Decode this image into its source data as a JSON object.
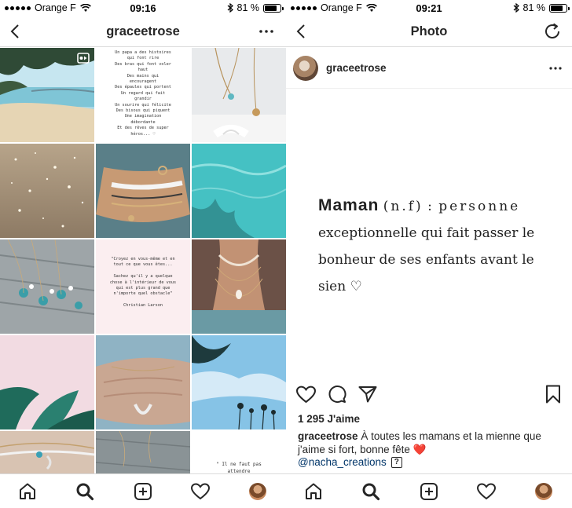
{
  "status_left": {
    "carrier": "Orange F",
    "time": "09:16",
    "battery": "81 %",
    "battery_level": 0.81
  },
  "status_right": {
    "carrier": "Orange F",
    "time": "09:21",
    "battery": "81 %",
    "battery_level": 0.81
  },
  "profile": {
    "username": "graceetrose"
  },
  "grid": {
    "quote1": "Un papa a des histoires\nqui font rire\nDes bras qui font voler\nhaut\nDes mains qui\nencouragent\nDes épaules qui portent\nUn regard qui fait\ngrandir\nUn sourire qui félicite\nDes bisous qui piquent\nUne imagination\ndébordante\nEt des rêves de super\nhéros... ♡",
    "quote2": "\"Croyez en vous-même et en\ntout ce que vous êtes...\n\nSachez qu'il y a quelque\nchose à l'intérieur de vous\nqui est plus grand que\nn'importe quel obstacle\"\n\nChristian Larson",
    "quote3": "\" Il ne faut pas\nattendre"
  },
  "post": {
    "nav_title": "Photo",
    "username": "graceetrose",
    "image_text": {
      "word": "Maman",
      "type": "(n.f)",
      "colon": ":",
      "first_def": "personne",
      "rest": "exceptionnelle qui fait passer le bonheur de ses enfants avant le sien ♡"
    },
    "likes": "1 295 J'aime",
    "caption_user": "graceetrose",
    "caption_text": "À toutes les mamans et la mienne que j'aime si fort, bonne fête ❤️",
    "mention": "@nacha_creations",
    "mention_badge": "?"
  },
  "colors": {
    "link": "#003569",
    "border": "#dbdbdb",
    "text": "#262626"
  },
  "icons": [
    "back-icon",
    "more-icon",
    "igtv-icon",
    "refresh-icon",
    "heart-icon",
    "comment-icon",
    "share-icon",
    "bookmark-icon",
    "home-icon",
    "search-icon",
    "add-icon",
    "activity-icon",
    "profile-avatar"
  ]
}
